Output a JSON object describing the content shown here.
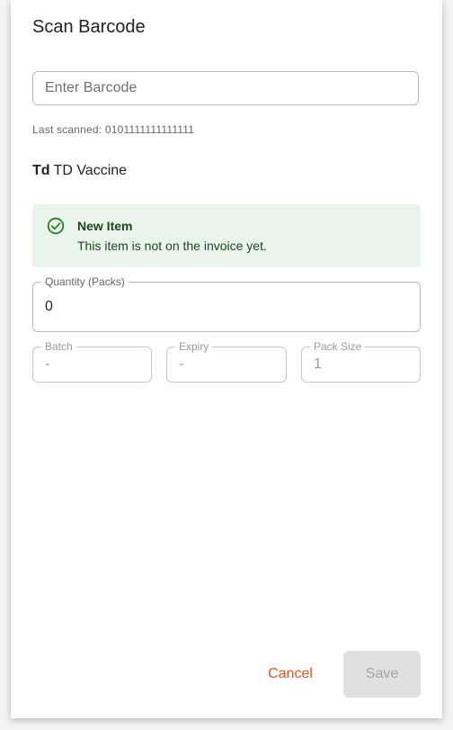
{
  "dialog": {
    "title": "Scan Barcode",
    "barcode_input": {
      "placeholder": "Enter Barcode",
      "value": ""
    },
    "last_scanned": "Last scanned: 0101111111111111",
    "item": {
      "code": "Td",
      "name": "TD Vaccine"
    },
    "alert": {
      "icon": "check-circle-icon",
      "title": "New Item",
      "message": "This item is not on the invoice yet.",
      "color": "#1e4620",
      "background": "#e9f5ea"
    },
    "fields": {
      "quantity": {
        "label": "Quantity (Packs)",
        "value": "0"
      },
      "batch": {
        "label": "Batch",
        "value": "-"
      },
      "expiry": {
        "label": "Expiry",
        "value": "-"
      },
      "pack_size": {
        "label": "Pack Size",
        "value": "1"
      }
    },
    "actions": {
      "cancel_label": "Cancel",
      "save_label": "Save",
      "accent_color": "#e9501e"
    }
  }
}
